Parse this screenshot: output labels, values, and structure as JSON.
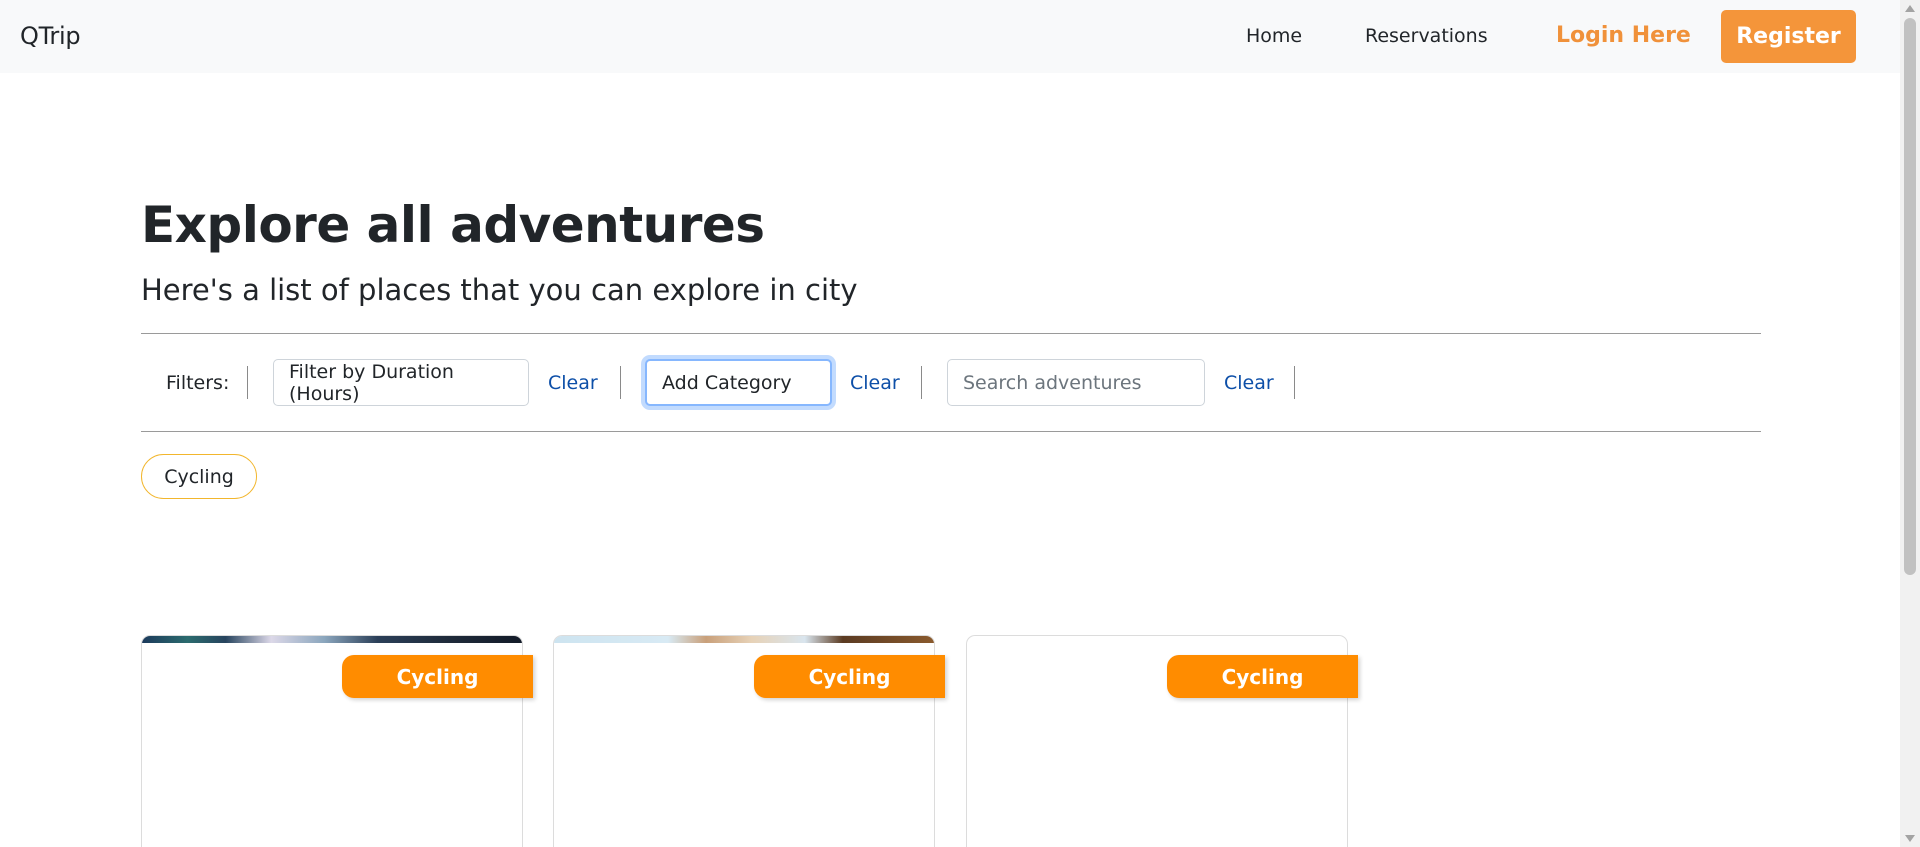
{
  "navbar": {
    "brand": "QTrip",
    "home": "Home",
    "reservations": "Reservations",
    "login": "Login Here",
    "register": "Register"
  },
  "main": {
    "title": "Explore all adventures",
    "subtitle": "Here's a list of places that you can explore in city"
  },
  "filters": {
    "label": "Filters:",
    "duration_select": "Filter by Duration (Hours)",
    "category_select": "Add Category",
    "search_placeholder": "Search adventures",
    "search_value": "",
    "clear_label": "Clear"
  },
  "active_categories": [
    "Cycling"
  ],
  "cards": [
    {
      "category": "Cycling"
    },
    {
      "category": "Cycling"
    },
    {
      "category": "Cycling"
    }
  ],
  "colors": {
    "accent": "#f4953a",
    "banner": "#ff8c00",
    "link": "#0d4fa8",
    "navbar_bg": "#f8f9fa"
  }
}
